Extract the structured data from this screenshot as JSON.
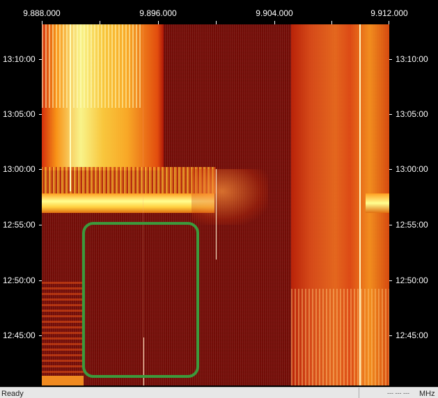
{
  "frequency_axis": {
    "labels": [
      "9.888.000",
      "9.896.000",
      "9.904.000",
      "9.912.000"
    ],
    "unit": "MHz",
    "readout": "--- --- ---"
  },
  "time_axis": {
    "labels": [
      "13:10:00",
      "13:05:00",
      "13:00:00",
      "12:55:00",
      "12:50:00",
      "12:45:00"
    ]
  },
  "highlight_color": "#3c9a3c",
  "colors": {
    "waterfall_background": "#7a0e08",
    "signal_hot": "#ffff80",
    "signal_warm": "#ff8a10",
    "signal_mid": "#d62a0a",
    "status_bar": "#e7e7e7"
  },
  "status": {
    "text": "Ready"
  }
}
